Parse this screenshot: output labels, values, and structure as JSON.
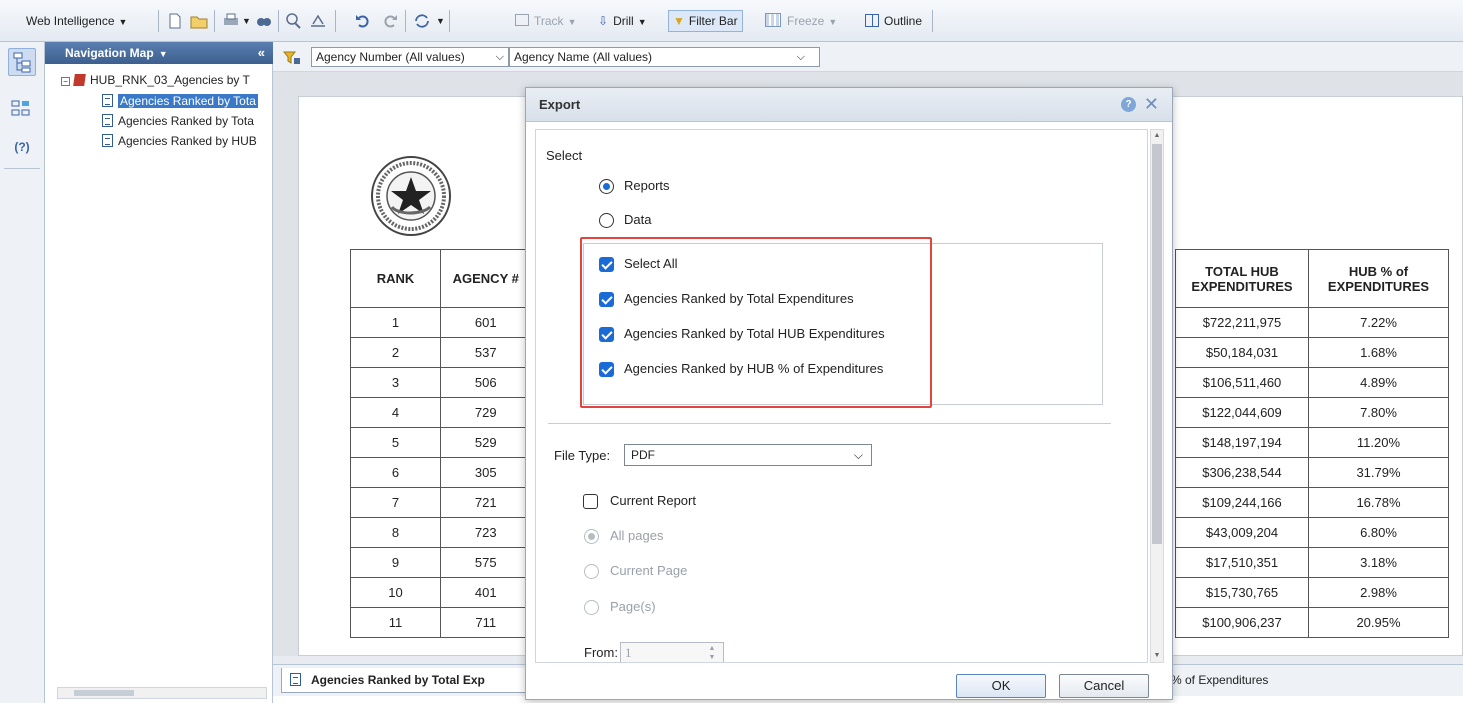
{
  "toolbar": {
    "app_menu": "Web Intelligence",
    "track": "Track",
    "drill": "Drill",
    "filter_bar": "Filter Bar",
    "freeze": "Freeze",
    "outline": "Outline"
  },
  "nav": {
    "title": "Navigation Map",
    "doc_name": "HUB_RNK_03_Agencies by T",
    "items": [
      {
        "label": "Agencies Ranked by Tota",
        "selected": true
      },
      {
        "label": "Agencies Ranked by Tota",
        "selected": false
      },
      {
        "label": "Agencies Ranked by HUB",
        "selected": false
      }
    ]
  },
  "filters": {
    "agency_number": "Agency Number (All values)",
    "agency_name": "Agency Name (All values)"
  },
  "report": {
    "headers": {
      "rank": "RANK",
      "agency": "AGENCY #",
      "total_hub": "TOTAL HUB EXPENDITURES",
      "hub_pct": "HUB % of EXPENDITURES"
    },
    "rows": [
      {
        "rank": "1",
        "agency": "601",
        "total_hub": "$722,211,975",
        "hub_pct": "7.22%"
      },
      {
        "rank": "2",
        "agency": "537",
        "total_hub": "$50,184,031",
        "hub_pct": "1.68%"
      },
      {
        "rank": "3",
        "agency": "506",
        "total_hub": "$106,511,460",
        "hub_pct": "4.89%"
      },
      {
        "rank": "4",
        "agency": "729",
        "total_hub": "$122,044,609",
        "hub_pct": "7.80%"
      },
      {
        "rank": "5",
        "agency": "529",
        "total_hub": "$148,197,194",
        "hub_pct": "11.20%"
      },
      {
        "rank": "6",
        "agency": "305",
        "total_hub": "$306,238,544",
        "hub_pct": "31.79%"
      },
      {
        "rank": "7",
        "agency": "721",
        "total_hub": "$109,244,166",
        "hub_pct": "16.78%"
      },
      {
        "rank": "8",
        "agency": "723",
        "total_hub": "$43,009,204",
        "hub_pct": "6.80%"
      },
      {
        "rank": "9",
        "agency": "575",
        "total_hub": "$17,510,351",
        "hub_pct": "3.18%"
      },
      {
        "rank": "10",
        "agency": "401",
        "total_hub": "$15,730,765",
        "hub_pct": "2.98%"
      },
      {
        "rank": "11",
        "agency": "711",
        "total_hub": "$100,906,237",
        "hub_pct": "20.95%"
      }
    ]
  },
  "tabs": {
    "active": "Agencies Ranked by Total Exp",
    "other": "% of Expenditures"
  },
  "dialog": {
    "title": "Export",
    "help": "?",
    "close": "✕",
    "select_label": "Select",
    "radio_reports": "Reports",
    "radio_data": "Data",
    "select_all": "Select All",
    "reports": [
      "Agencies Ranked by Total Expenditures",
      "Agencies Ranked by Total HUB Expenditures",
      "Agencies Ranked by HUB % of Expenditures"
    ],
    "file_type_label": "File Type:",
    "file_type_value": "PDF",
    "current_report": "Current Report",
    "all_pages": "All pages",
    "current_page": "Current Page",
    "pages": "Page(s)",
    "from_label": "From:",
    "from_value": "1",
    "ok": "OK",
    "cancel": "Cancel"
  },
  "colors": {
    "highlight": "#e0463f",
    "checkbox": "#1a6bd6",
    "nav_header": "#3c5f8f",
    "selected": "#3a78c8"
  }
}
